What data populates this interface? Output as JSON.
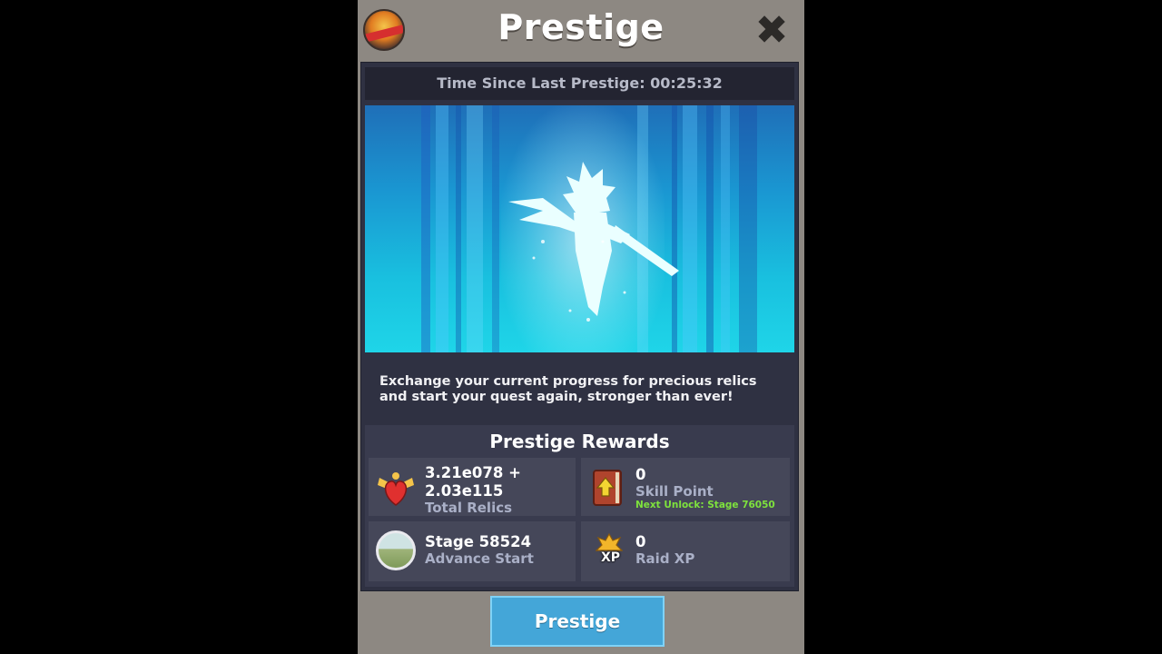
{
  "header": {
    "title": "Prestige",
    "close_glyph": "✖"
  },
  "timer": {
    "label": "Time Since Last Prestige: 00:25:32"
  },
  "description": "Exchange your current progress for precious relics and start your quest again, stronger than ever!",
  "rewards": {
    "title": "Prestige Rewards",
    "relics": {
      "value_line1": "3.21e078 +",
      "value_line2": "2.03e115",
      "label": "Total Relics",
      "icon": "winged-heart-icon"
    },
    "skill": {
      "value": "0",
      "label": "Skill Point",
      "unlock": "Next Unlock: Stage 76050",
      "icon": "skill-book-icon"
    },
    "stage": {
      "value": "Stage 58524",
      "label": "Advance Start",
      "icon": "landscape-icon"
    },
    "raid": {
      "value": "0",
      "label": "Raid XP",
      "badge": "XP",
      "icon": "raid-xp-icon"
    }
  },
  "prestige_button": {
    "label": "Prestige"
  },
  "colors": {
    "accent_button": "#44a6d8",
    "panel_background": "#2f3142",
    "unlock_text": "#7ee23d"
  }
}
